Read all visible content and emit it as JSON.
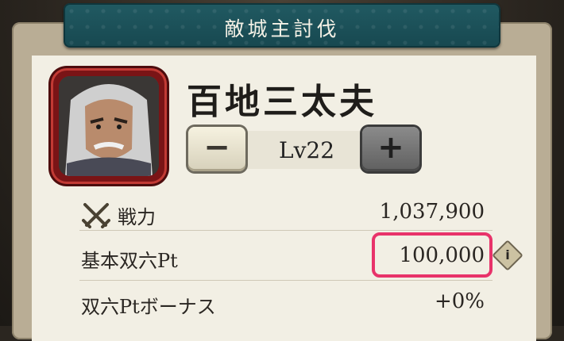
{
  "title": "敵城主討伐",
  "commander": {
    "name": "百地三太夫",
    "level_label": "Lv22"
  },
  "controls": {
    "minus_symbol": "−",
    "plus_symbol": "+"
  },
  "stats": [
    {
      "label": "戦力",
      "value": "1,037,900",
      "icon": "crossed-swords-icon"
    },
    {
      "label": "基本双六Pt",
      "value": "100,000",
      "highlighted": true
    },
    {
      "label": "双六Ptボーナス",
      "value": "+0%"
    }
  ],
  "info_icon_glyph": "i",
  "colors": {
    "banner": "#1b4e56",
    "portrait_frame": "#7a1416",
    "highlight": "#e8336a"
  }
}
